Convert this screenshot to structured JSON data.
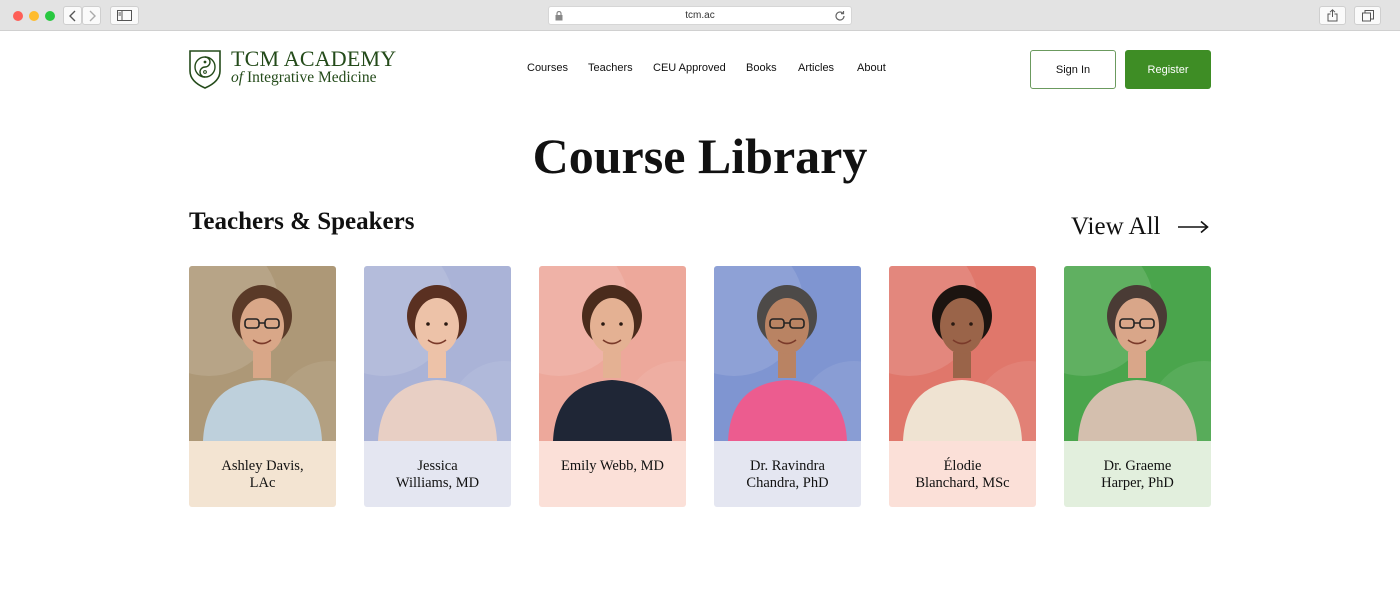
{
  "browser": {
    "url": "tcm.ac"
  },
  "brand": {
    "name_line1": "TCM ACADEMY",
    "name_line2_prefix": "of",
    "name_line2_rest": " Integrative Medicine",
    "color": "#244b1a"
  },
  "nav": {
    "items": [
      {
        "label": "Courses"
      },
      {
        "label": "Teachers"
      },
      {
        "label": "CEU Approved"
      },
      {
        "label": "Books"
      },
      {
        "label": "Articles"
      },
      {
        "label": "About"
      }
    ]
  },
  "auth": {
    "signin_label": "Sign In",
    "register_label": "Register",
    "accent": "#3e8d25"
  },
  "main": {
    "page_title": "Course Library",
    "section_title": "Teachers & Speakers",
    "view_all_label": "View All"
  },
  "teachers": [
    {
      "line1": "Ashley Davis,",
      "line2": "LAc",
      "caption_bg": "#f3e4d2",
      "photo_bg": "#ad9877",
      "shirt": "#bed0dc",
      "hair": "#5a3a28",
      "skin": "#d9a788",
      "glasses": true
    },
    {
      "line1": "Jessica",
      "line2": "Williams, MD",
      "caption_bg": "#e4e6f1",
      "photo_bg": "#aab3d7",
      "shirt": "#e8cfc4",
      "hair": "#5a3021",
      "skin": "#edc2a8",
      "glasses": false
    },
    {
      "line1": "Emily Webb, MD",
      "line2": "",
      "caption_bg": "#fbe0d8",
      "photo_bg": "#eda89b",
      "shirt": "#1f2636",
      "hair": "#4a2b1c",
      "skin": "#e4b193",
      "glasses": false
    },
    {
      "line1": "Dr. Ravindra",
      "line2": "Chandra, PhD",
      "caption_bg": "#e4e6f1",
      "photo_bg": "#7f95d1",
      "shirt": "#ec5c8f",
      "hair": "#4d4a48",
      "skin": "#b98363",
      "glasses": true
    },
    {
      "line1": "Élodie",
      "line2": "Blanchard, MSc",
      "caption_bg": "#fbe0d8",
      "photo_bg": "#e0776b",
      "shirt": "#efe3d2",
      "hair": "#1c1410",
      "skin": "#9a6449",
      "glasses": false
    },
    {
      "line1": "Dr. Graeme",
      "line2": "Harper, PhD",
      "caption_bg": "#e2efdd",
      "photo_bg": "#4aa54c",
      "shirt": "#d4bfae",
      "hair": "#4a3b35",
      "skin": "#d9a689",
      "glasses": true
    }
  ]
}
